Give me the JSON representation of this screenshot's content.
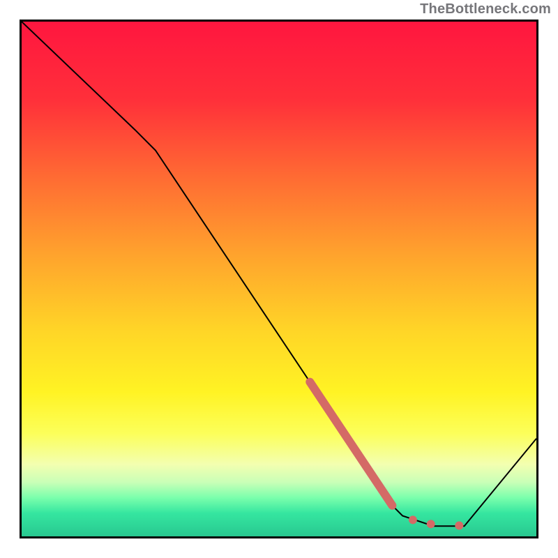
{
  "attribution": "TheBottleneck.com",
  "chart_data": {
    "type": "line",
    "title": "",
    "xlabel": "",
    "ylabel": "",
    "xlim": [
      0,
      100
    ],
    "ylim": [
      0,
      100
    ],
    "background": {
      "style": "vertical-gradient",
      "stops": [
        {
          "offset": 0.0,
          "color": "#ff163f"
        },
        {
          "offset": 0.15,
          "color": "#ff2f3a"
        },
        {
          "offset": 0.3,
          "color": "#ff6a33"
        },
        {
          "offset": 0.45,
          "color": "#ffa22d"
        },
        {
          "offset": 0.6,
          "color": "#ffd527"
        },
        {
          "offset": 0.72,
          "color": "#fff324"
        },
        {
          "offset": 0.8,
          "color": "#fcff5a"
        },
        {
          "offset": 0.86,
          "color": "#f3ffb0"
        },
        {
          "offset": 0.895,
          "color": "#c9ffb7"
        },
        {
          "offset": 0.925,
          "color": "#7affac"
        },
        {
          "offset": 0.955,
          "color": "#35e6a0"
        },
        {
          "offset": 1.0,
          "color": "#28c890"
        }
      ]
    },
    "series": [
      {
        "name": "bottleneck-curve",
        "x": [
          0,
          22,
          26,
          64,
          72,
          74,
          80,
          86,
          100
        ],
        "y": [
          100,
          79,
          75,
          18,
          6,
          4,
          2,
          2,
          19
        ],
        "stroke": "#000000",
        "stroke_width_px": 2
      }
    ],
    "annotations": {
      "highlight_segment": {
        "name": "recommended-range-bar",
        "color": "#d46a66",
        "opacity": 1.0,
        "thickness_px": 12,
        "x0": 56,
        "y0": 30,
        "x1": 72,
        "y1": 6
      },
      "highlight_dots": {
        "name": "recommended-dots",
        "color": "#d46a66",
        "radius_px": 6,
        "points": [
          {
            "x": 76,
            "y": 3.2
          },
          {
            "x": 79.5,
            "y": 2.4
          },
          {
            "x": 85,
            "y": 2.1
          }
        ]
      }
    }
  }
}
